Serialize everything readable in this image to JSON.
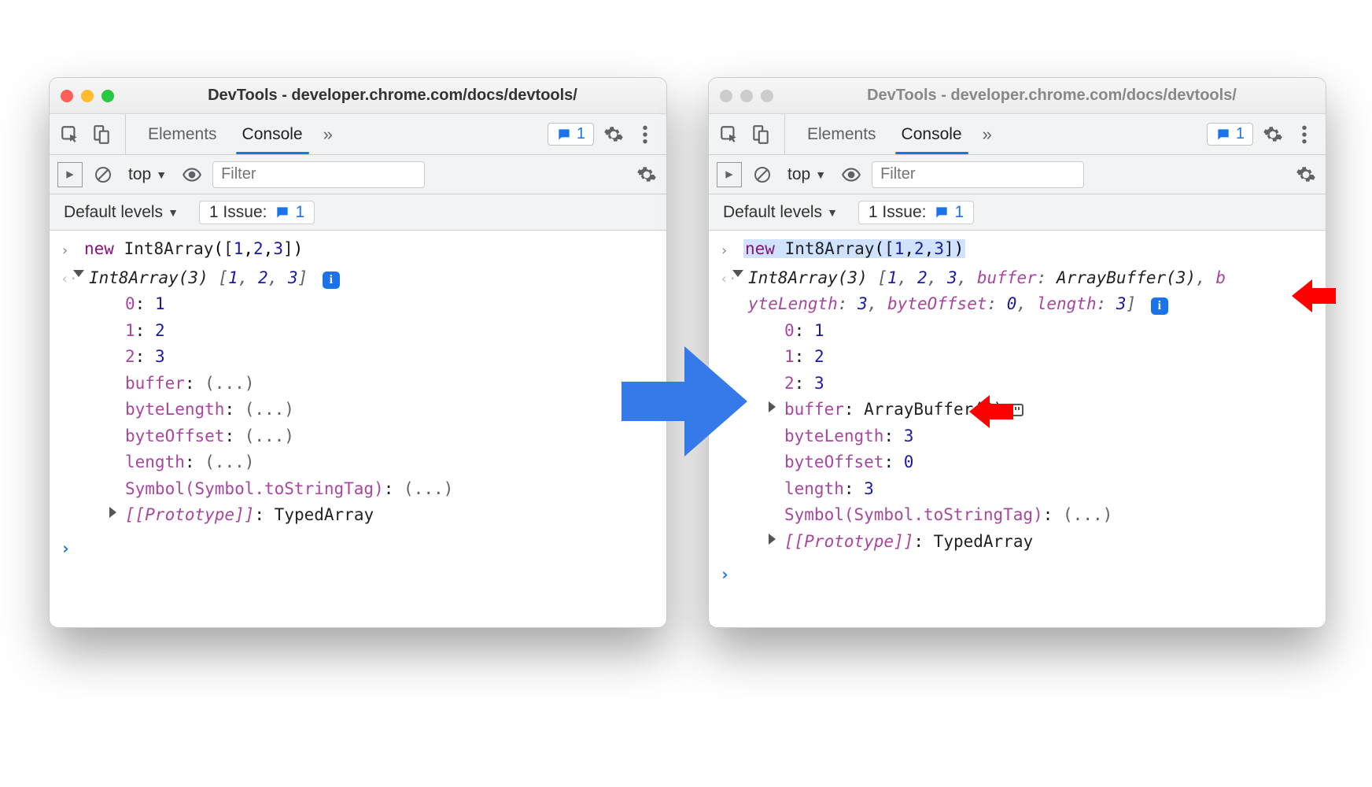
{
  "windowTitle": "DevTools - developer.chrome.com/docs/devtools/",
  "tabs": {
    "elements": "Elements",
    "console": "Console",
    "more": "»"
  },
  "issuesBadge": "1",
  "subbar": {
    "context": "top",
    "filterPlaceholder": "Filter"
  },
  "levels": {
    "default": "Default levels",
    "issueLabel": "1 Issue:",
    "issueCount": "1"
  },
  "left": {
    "input": "new Int8Array([1,2,3])",
    "preview": "Int8Array(3) [1, 2, 3]",
    "props": {
      "i0k": "0",
      "i0v": "1",
      "i1k": "1",
      "i1v": "2",
      "i2k": "2",
      "i2v": "3",
      "buffer": "buffer",
      "bufferv": "(...)",
      "byteLength": "byteLength",
      "byteLengthv": "(...)",
      "byteOffset": "byteOffset",
      "byteOffsetv": "(...)",
      "length": "length",
      "lengthv": "(...)",
      "symbol": "Symbol(Symbol.toStringTag)",
      "symbolv": "(...)",
      "proto": "[[Prototype]]",
      "protov": "TypedArray"
    }
  },
  "right": {
    "input": "new Int8Array([1,2,3])",
    "previewA": "Int8Array(3) [1, 2, 3, buffer: ArrayBuffer(3), b",
    "previewB": "yteLength: 3, byteOffset: 0, length: 3]",
    "props": {
      "i0k": "0",
      "i0v": "1",
      "i1k": "1",
      "i1v": "2",
      "i2k": "2",
      "i2v": "3",
      "buffer": "buffer",
      "bufferv": "ArrayBuffer(3)",
      "byteLength": "byteLength",
      "byteLengthv": "3",
      "byteOffset": "byteOffset",
      "byteOffsetv": "0",
      "length": "length",
      "lengthv": "3",
      "symbol": "Symbol(Symbol.toStringTag)",
      "symbolv": "(...)",
      "proto": "[[Prototype]]",
      "protov": "TypedArray"
    }
  }
}
